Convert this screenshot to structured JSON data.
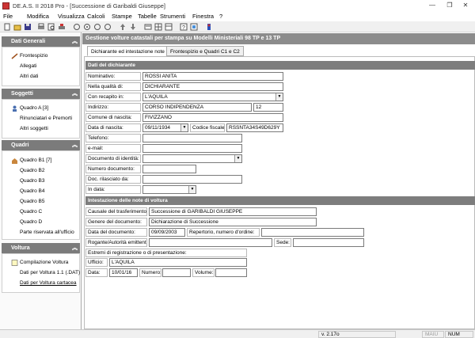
{
  "window": {
    "title": "DE.A.S. II 2018 Pro - [Successione di Garibaldi Giuseppe]"
  },
  "menu": [
    "File",
    "Modifica",
    "Visualizza",
    "Calcoli",
    "Stampe",
    "Tabelle",
    "Strumenti",
    "Finestra",
    "?"
  ],
  "sidebar": {
    "sections": [
      {
        "title": "Dati Generali",
        "items": [
          "Frontespizio",
          "Allegati",
          "Altri dati"
        ]
      },
      {
        "title": "Soggetti",
        "items": [
          "Quadro A [3]",
          "Rinunciatari e Premorti",
          "Altri soggetti"
        ]
      },
      {
        "title": "Quadri",
        "items": [
          "Quadro B1 [7]",
          "Quadro B2",
          "Quadro B3",
          "Quadro B4",
          "Quadro B5",
          "Quadro C",
          "Quadro D",
          "Parte riservata all'ufficio"
        ]
      },
      {
        "title": "Voltura",
        "items": [
          "Compilazione Voltura",
          "Dati per Voltura 1.1 (.DAT)",
          "Dati per Voltura cartacea"
        ]
      }
    ]
  },
  "main": {
    "heading": "Gestione volture catastali per stampa su Modelli Ministeriali 98 TP e 13 TP",
    "tabs": [
      "Dichiarante ed intestazione note",
      "Frontespizio e Quadri C1 e C2"
    ],
    "dichiarante": {
      "title": "Dati del dichiarante",
      "nominativo_label": "Nominativo:",
      "nominativo": "ROSSI ANITA",
      "qualita_label": "Nella qualità di:",
      "qualita": "DICHIARANTE",
      "recapito_label": "Con recapito in:",
      "recapito": "L'AQUILA",
      "indirizzo_label": "Indirizzo:",
      "indirizzo": "CORSO INDIPENDENZA",
      "civico": "12",
      "comune_label": "Comune di nascita:",
      "comune": "FIVIZZANO",
      "data_label": "Data di nascita:",
      "data": "09/11/1934",
      "cf_label": "Codice fiscale:",
      "cf": "RSSNTA34S49D629Y",
      "telefono_label": "Telefono:",
      "email_label": "e-mail:",
      "documento_label": "Documento di identità:",
      "numero_label": "Numero documento:",
      "rilasciato_label": "Doc. rilasciato da:",
      "indata_label": "In data:"
    },
    "intestazione": {
      "title": "Intestazione delle note di voltura",
      "causale_label": "Causale del trasferimento:",
      "causale": "Successione di GARIBALDI GIUSEPPE",
      "genere_label": "Genere del documento:",
      "genere": "Dichiarazione di Successione",
      "datadoc_label": "Data del documento:",
      "datadoc": "09/09/2003",
      "repertorio_label": "Repertorio, numero d'ordine:",
      "rogante_label": "Rogante/Autorità emittente:",
      "sede_label": "Sede:",
      "estremi_label": "Estremi di registrazione o di presentazione:",
      "ufficio_label": "Ufficio:",
      "ufficio": "L'AQUILA",
      "data_label": "Data:",
      "data": "10/01/16",
      "numero_label": "Numero:",
      "volume_label": "Volume:"
    }
  },
  "status": {
    "version": "v. 2.17o",
    "caps": "MAIU",
    "num": "NUM"
  }
}
